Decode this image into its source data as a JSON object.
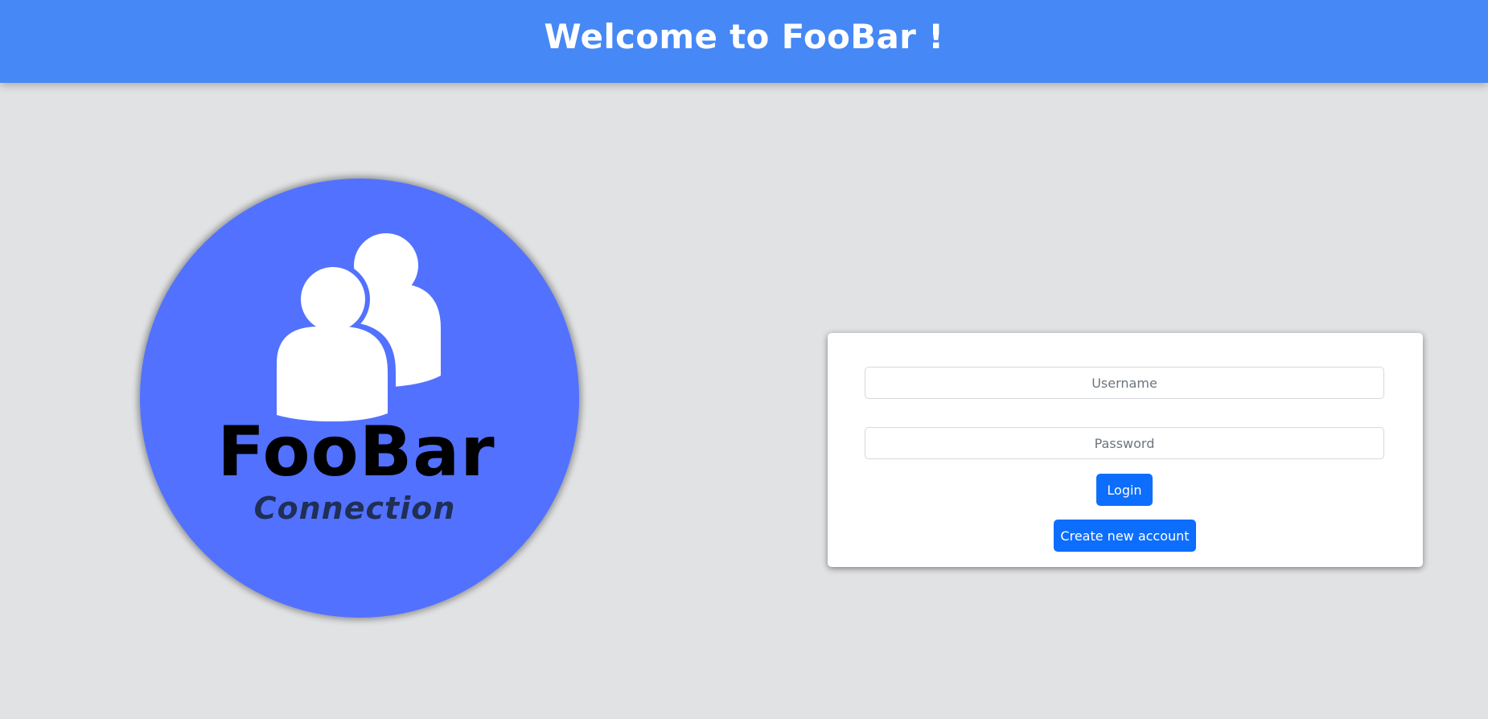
{
  "header": {
    "title": "Welcome to FooBar !"
  },
  "logo": {
    "name": "FooBar",
    "subtitle": "Connection",
    "icon": "users-icon",
    "background_color": "#5271ff"
  },
  "login_form": {
    "username_placeholder": "Username",
    "username_value": "",
    "password_placeholder": "Password",
    "password_value": "",
    "login_label": "Login",
    "create_account_label": "Create new account"
  },
  "colors": {
    "header": "#4688f5",
    "page_background": "#e1e2e4",
    "primary_button": "#0d6efd"
  }
}
